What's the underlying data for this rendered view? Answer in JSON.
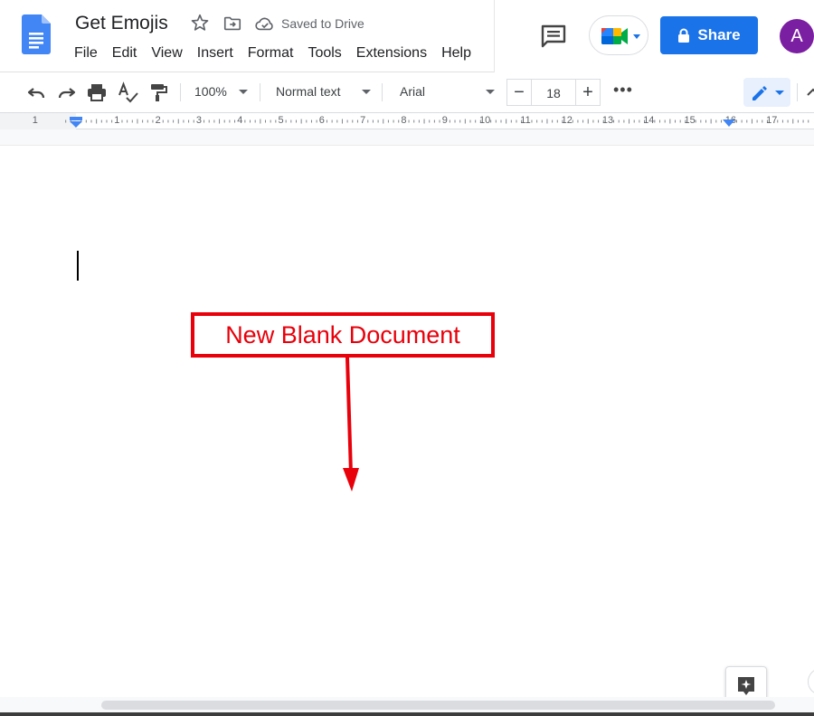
{
  "header": {
    "doc_title": "Get Emojis",
    "save_status": "Saved to Drive",
    "menu": [
      "File",
      "Edit",
      "View",
      "Insert",
      "Format",
      "Tools",
      "Extensions",
      "Help"
    ],
    "share_label": "Share",
    "avatar_initial": "A",
    "colors": {
      "share": "#1a73e8",
      "avatar": "#7b1fa2",
      "docs_logo": "#4285f4"
    }
  },
  "toolbar": {
    "zoom": "100%",
    "style": "Normal text",
    "font": "Arial",
    "font_size": "18",
    "minus": "−",
    "plus": "+",
    "more": "•••"
  },
  "ruler": {
    "numbers": [
      "1",
      "1",
      "2",
      "3",
      "4",
      "5",
      "6",
      "7",
      "8",
      "9",
      "10",
      "11",
      "12",
      "13",
      "14",
      "15",
      "16",
      "17"
    ]
  },
  "annotation": {
    "callout_text": "New Blank Document",
    "color": "#e8000b"
  }
}
